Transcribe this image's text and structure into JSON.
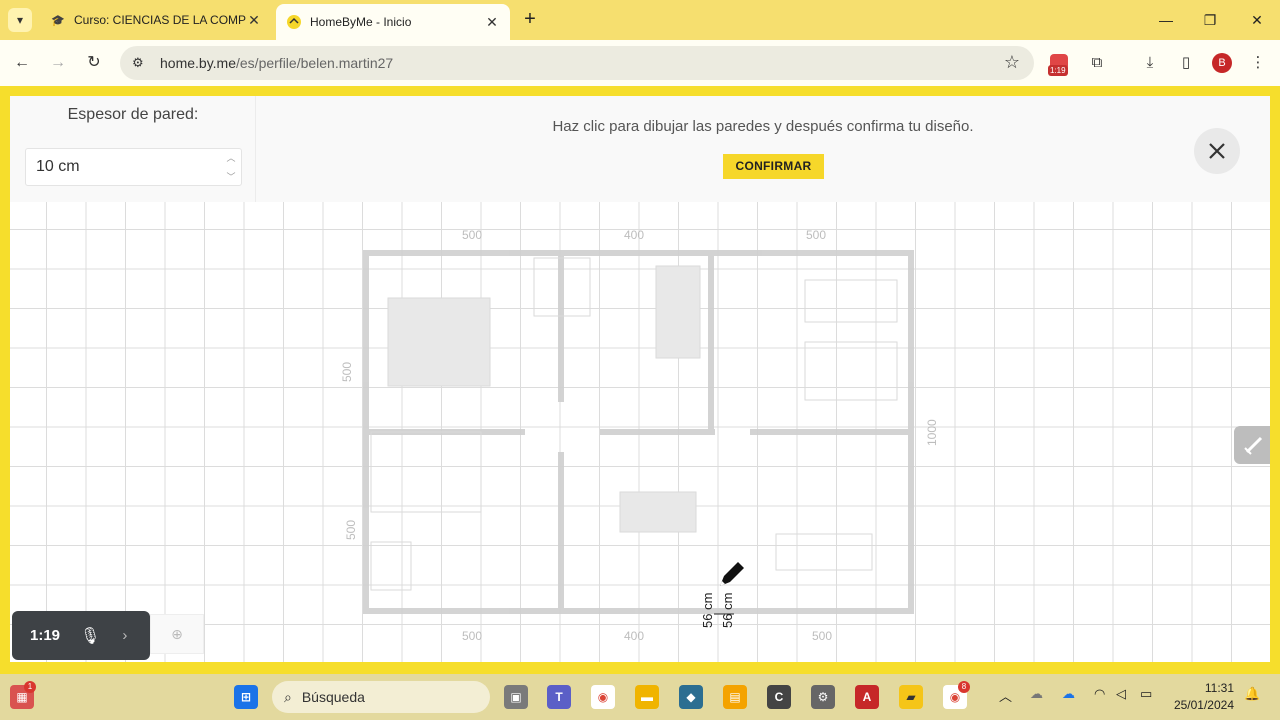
{
  "browser": {
    "tabs": [
      {
        "title": "Curso: CIENCIAS DE LA COMPU",
        "favicon": "graduation-cap-icon",
        "active": false
      },
      {
        "title": "HomeByMe - Inicio",
        "favicon": "homebyme-icon",
        "active": true
      }
    ],
    "url_host": "home.by.me",
    "url_path": "/es/perfile/belen.martin27",
    "timer_badge": "1:19",
    "profile_initial": "B"
  },
  "editor": {
    "thickness_label": "Espesor de pared:",
    "thickness_value": "10 cm",
    "instruction": "Haz clic para dibujar las paredes y después confirma tu diseño.",
    "confirm_label": "CONFIRMAR",
    "measure_a": "56 cm",
    "measure_b": "56 cm"
  },
  "floorplan_dimensions": {
    "top": [
      "500",
      "400",
      "500"
    ],
    "bottom": [
      "500",
      "400",
      "500"
    ],
    "left": [
      "500",
      "500"
    ],
    "right": [
      "1000"
    ]
  },
  "recorder": {
    "time": "1:19"
  },
  "taskbar": {
    "search_placeholder": "Búsqueda",
    "time": "11:31",
    "date": "25/01/2024",
    "chrome_badge": "8",
    "widget_badge": "1"
  },
  "colors": {
    "accent_yellow": "#f6d72a",
    "browser_frame": "#f6df6f",
    "taskbar": "#e3d99e"
  }
}
